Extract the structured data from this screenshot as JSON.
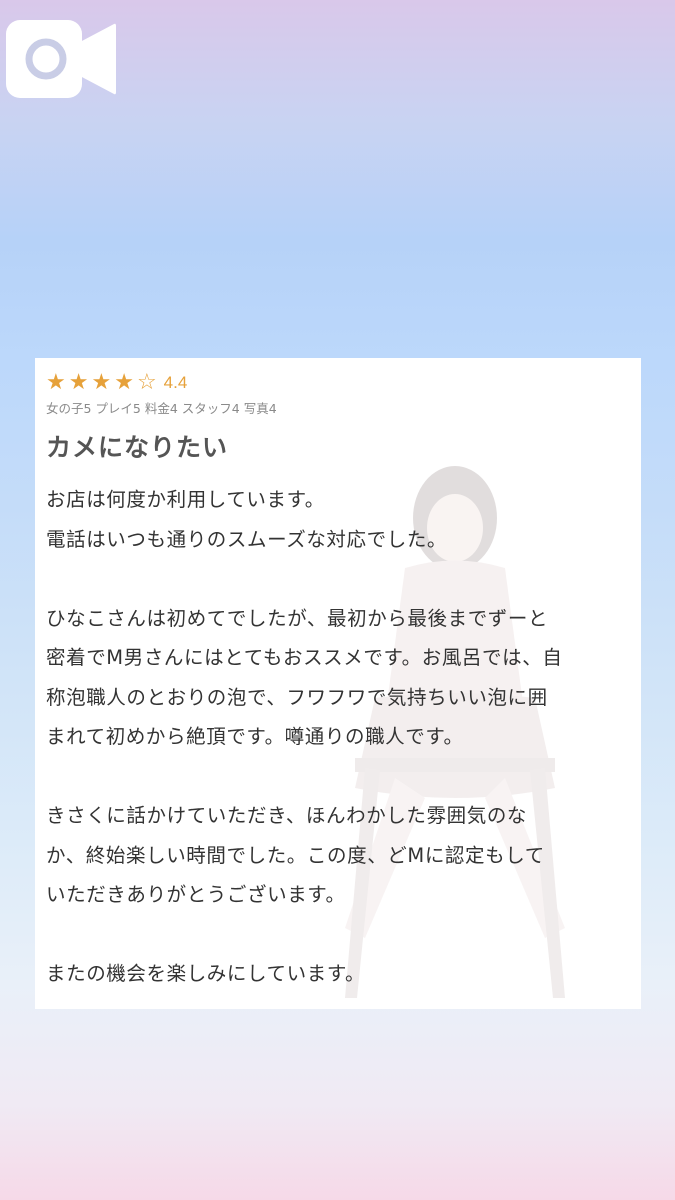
{
  "icons": {
    "video": "video-camera-icon"
  },
  "colors": {
    "star": "#e6a13a",
    "title": "#555555",
    "body": "#333333",
    "subscores": "#8a8a8a"
  },
  "review": {
    "stars_filled": 4,
    "stars_total": 5,
    "rating_value": "4.4",
    "sub_scores": "女の子5 プレイ5 料金4 スタッフ4 写真4",
    "title": "カメになりたい",
    "lines": [
      "お店は何度か利用しています。",
      "電話はいつも通りのスムーズな対応でした。",
      "",
      "ひなこさんは初めてでしたが、最初から最後までずーと",
      "密着でM男さんにはとてもおススメです。お風呂では、自",
      "称泡職人のとおりの泡で、フワフワで気持ちいい泡に囲",
      "まれて初めから絶頂です。噂通りの職人です。",
      "",
      "きさくに話かけていただき、ほんわかした雰囲気のな",
      "か、終始楽しい時間でした。この度、どMに認定もして",
      "いただきありがとうございます。",
      "",
      "またの機会を楽しみにしています。"
    ]
  }
}
